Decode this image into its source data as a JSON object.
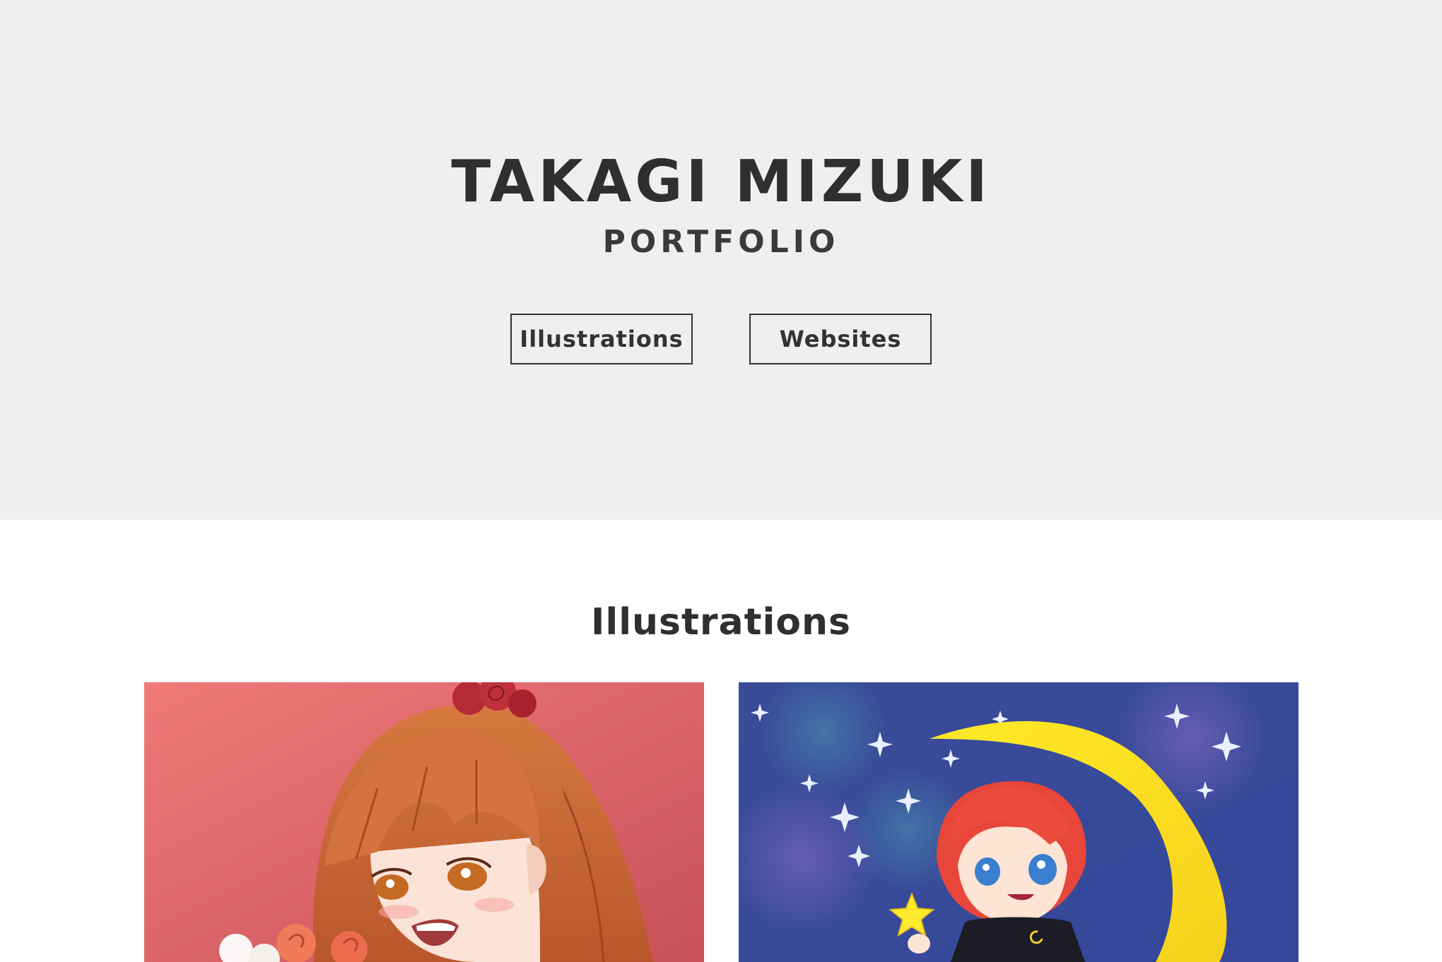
{
  "hero": {
    "title": "TAKAGI MIZUKI",
    "subtitle": "PORTFOLIO",
    "buttons": [
      "Illustrations",
      "Websites"
    ]
  },
  "illustrations": {
    "heading": "Illustrations",
    "items": [
      {
        "icon": "portrait-illustration-girl-with-roses",
        "accent": "#e86a6a"
      },
      {
        "icon": "moon-illustration-chibi-boy-with-star",
        "accent": "#3d4f9a"
      }
    ]
  },
  "colors": {
    "hero_bg": "#efefef",
    "text": "#333333",
    "page_bg": "#ffffff"
  }
}
